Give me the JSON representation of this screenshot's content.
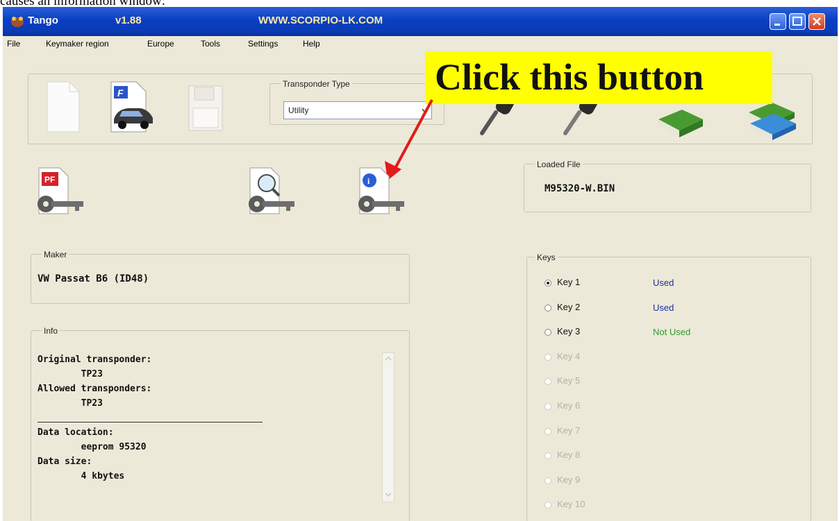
{
  "caption": "causes an information window:",
  "titlebar": {
    "app_name": "Tango",
    "version": "v1.88",
    "website": "WWW.SCORPIO-LK.COM"
  },
  "menu": [
    "File",
    "Keymaker region",
    "Europe",
    "Tools",
    "Settings",
    "Help"
  ],
  "transponder": {
    "label": "Transponder Type",
    "value": "Utility"
  },
  "callout": {
    "text": "Click this button",
    "bg_color": "#ffff00",
    "arrow_color": "#e21b1b"
  },
  "loaded_file": {
    "label": "Loaded File",
    "value": "M95320-W.BIN"
  },
  "maker": {
    "label": "Maker",
    "value": "VW Passat B6 (ID48)"
  },
  "info": {
    "label": "Info",
    "lines": [
      "Original transponder:",
      "        TP23",
      "Allowed transponders:",
      "        TP23",
      "",
      "Data location:",
      "        eeprom 95320",
      "Data size:",
      "        4 kbytes"
    ]
  },
  "keys": {
    "label": "Keys",
    "items": [
      {
        "label": "Key 1",
        "status": "Used",
        "selected": true,
        "enabled": true,
        "status_color": "#1a2f9e"
      },
      {
        "label": "Key 2",
        "status": "Used",
        "selected": false,
        "enabled": true,
        "status_color": "#1a2f9e"
      },
      {
        "label": "Key 3",
        "status": "Not Used",
        "selected": false,
        "enabled": true,
        "status_color": "#2f9a2f"
      },
      {
        "label": "Key 4",
        "status": "",
        "selected": false,
        "enabled": false
      },
      {
        "label": "Key 5",
        "status": "",
        "selected": false,
        "enabled": false
      },
      {
        "label": "Key 6",
        "status": "",
        "selected": false,
        "enabled": false
      },
      {
        "label": "Key 7",
        "status": "",
        "selected": false,
        "enabled": false
      },
      {
        "label": "Key 8",
        "status": "",
        "selected": false,
        "enabled": false
      },
      {
        "label": "Key 9",
        "status": "",
        "selected": false,
        "enabled": false
      },
      {
        "label": "Key 10",
        "status": "",
        "selected": false,
        "enabled": false
      }
    ]
  },
  "icons": {
    "toolbar": [
      "new-file-icon",
      "open-car-file-icon",
      "save-icon",
      "car-key-icon",
      "car-key-icon",
      "book-icon",
      "books-icon"
    ],
    "actions": [
      "pdf-key-icon",
      "search-key-icon",
      "info-key-icon"
    ]
  }
}
